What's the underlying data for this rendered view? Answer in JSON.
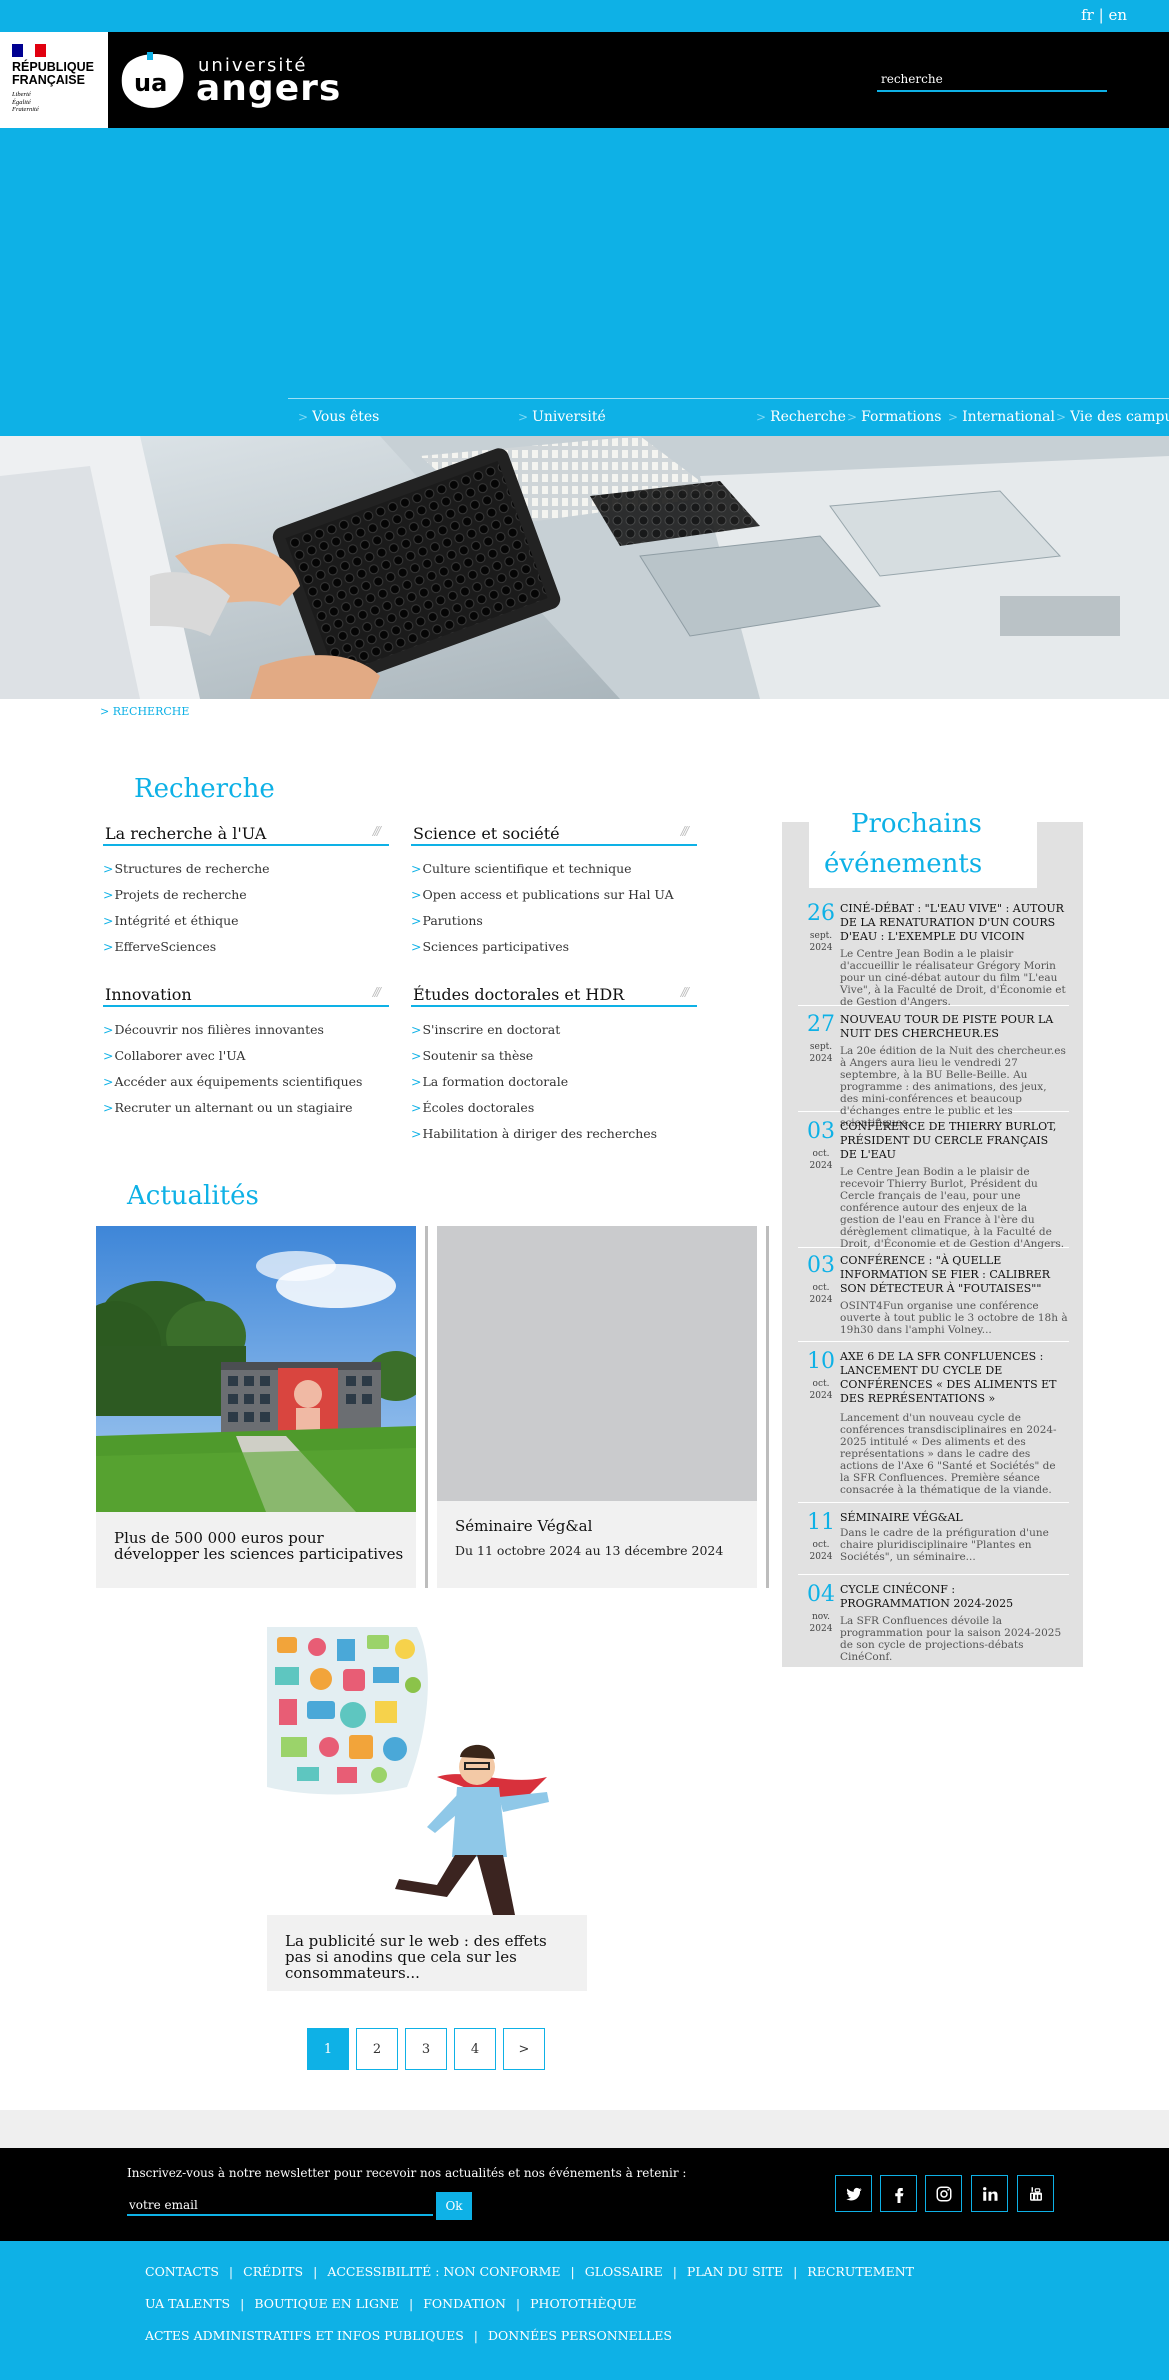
{
  "lang": {
    "fr": "fr",
    "separator": "|",
    "en": "en"
  },
  "header": {
    "rf": {
      "line1": "RÉPUBLIQUE",
      "line2": "FRANÇAISE",
      "motto1": "Liberté",
      "motto2": "Égalité",
      "motto3": "Fraternité"
    },
    "ua": {
      "word1": "université",
      "word2": "angers"
    },
    "search_placeholder": "recherche"
  },
  "nav": [
    "Vous êtes",
    "Université",
    "Recherche",
    "Formations",
    "International",
    "Vie des campus"
  ],
  "breadcrumb": "> RECHERCHE",
  "recherche": {
    "title": "Recherche",
    "columns": [
      {
        "heading": "La recherche à l'UA",
        "items": [
          "Structures de recherche",
          "Projets de recherche",
          "Intégrité et éthique",
          "EfferveSciences"
        ]
      },
      {
        "heading": "Science et société",
        "items": [
          "Culture scientifique et technique",
          "Open access et publications sur Hal UA",
          "Parutions",
          "Sciences participatives"
        ]
      },
      {
        "heading": "Innovation",
        "items": [
          "Découvrir nos filières innovantes",
          "Collaborer avec l'UA",
          "Accéder aux équipements scientifiques",
          "Recruter un alternant ou un stagiaire"
        ]
      },
      {
        "heading": "Études doctorales et HDR",
        "items": [
          "S'inscrire en doctorat",
          "Soutenir sa thèse",
          "La formation doctorale",
          "Écoles doctorales",
          "Habilitation à diriger des recherches"
        ]
      }
    ]
  },
  "actualites": {
    "title": "Actualités",
    "cards": [
      {
        "title": "Plus de 500 000 euros pour développer les sciences participatives"
      },
      {
        "title": "Séminaire Vég&al",
        "date": "Du 11 octobre 2024 au 13 décembre 2024"
      },
      {
        "title": "La publicité sur le web : des effets pas si anodins que cela sur les consommateurs..."
      }
    ]
  },
  "pagination": [
    "1",
    "2",
    "3",
    "4",
    ">"
  ],
  "events": {
    "title_line1": "Prochains",
    "title_line2": "événements",
    "items": [
      {
        "day": "26",
        "month": "sept.",
        "year": "2024",
        "title": "CINÉ-DÉBAT : \"L'EAU VIVE\" : AUTOUR DE LA RENATURATION D'UN COURS D'EAU : L'EXEMPLE DU VICOIN",
        "desc": "Le Centre Jean Bodin a le plaisir d'accueillir le réalisateur Grégory Morin pour un ciné-débat autour du film \"L'eau Vive\", à la Faculté de Droit, d'Économie et de Gestion d'Angers."
      },
      {
        "day": "27",
        "month": "sept.",
        "year": "2024",
        "title": "NOUVEAU TOUR DE PISTE POUR LA NUIT DES CHERCHEUR.ES",
        "desc": "La 20e édition de la Nuit des chercheur.es à Angers aura lieu le vendredi 27 septembre, à la BU Belle-Beille. Au programme : des animations, des jeux, des mini-conférences et beaucoup d'échanges entre le public et les scientifiques."
      },
      {
        "day": "03",
        "month": "oct.",
        "year": "2024",
        "title": "CONFÉRENCE DE THIERRY BURLOT, PRÉSIDENT DU CERCLE FRANÇAIS DE L'EAU",
        "desc": "Le Centre Jean Bodin a le plaisir de recevoir Thierry Burlot, Président du Cercle français de l'eau, pour une conférence autour des enjeux de la gestion de l'eau en France à l'ère du dérèglement climatique, à la Faculté de Droit, d'Économie et de Gestion d'Angers."
      },
      {
        "day": "03",
        "month": "oct.",
        "year": "2024",
        "title": "CONFÉRENCE : \"À QUELLE INFORMATION SE FIER : CALIBRER SON DÉTECTEUR À \"FOUTAISES\"\"",
        "desc": "OSINT4Fun organise une conférence ouverte à tout public le 3 octobre de 18h à 19h30 dans l'amphi Volney..."
      },
      {
        "day": "10",
        "month": "oct.",
        "year": "2024",
        "title": "AXE 6 DE LA SFR CONFLUENCES : LANCEMENT DU CYCLE DE CONFÉRENCES « DES ALIMENTS ET DES REPRÉSENTATIONS »",
        "desc": "Lancement d'un nouveau cycle de conférences transdisciplinaires en 2024-2025 intitulé « Des aliments et des représentations » dans le cadre des actions de l'Axe 6 \"Santé et Sociétés\" de la SFR Confluences. Première séance consacrée à la thématique de la viande."
      },
      {
        "day": "11",
        "month": "oct.",
        "year": "2024",
        "title": "SÉMINAIRE VÉG&AL",
        "desc": "Dans le cadre de la préfiguration d'une chaire pluridisciplinaire \"Plantes en Sociétés\", un séminaire..."
      },
      {
        "day": "04",
        "month": "nov.",
        "year": "2024",
        "title": "CYCLE CINÉCONF : PROGRAMMATION 2024-2025",
        "desc": "La SFR Confluences dévoile la programmation pour la saison 2024-2025 de son cycle de projections-débats CinéConf."
      }
    ]
  },
  "newsletter": {
    "text": "Inscrivez-vous à notre newsletter pour recevoir nos actualités et nos événements à retenir :",
    "placeholder": "votre email",
    "button": "Ok"
  },
  "social": [
    "twitter-icon",
    "facebook-icon",
    "instagram-icon",
    "linkedin-icon",
    "youtube-icon"
  ],
  "footer": {
    "row1": [
      "Contacts",
      "Crédits",
      "Accessibilité : non conforme",
      "Glossaire",
      "Plan du site",
      "Recrutement"
    ],
    "row2": [
      "UA Talents",
      "Boutique en ligne",
      "Fondation",
      "Photothèque"
    ],
    "row3": [
      "Actes administratifs et infos publiques",
      "Données personnelles"
    ],
    "separator": "|"
  },
  "colors": {
    "accent": "#0eb1e6",
    "black": "#000000",
    "panel": "#e1e1e1",
    "card": "#f1f1f1"
  }
}
